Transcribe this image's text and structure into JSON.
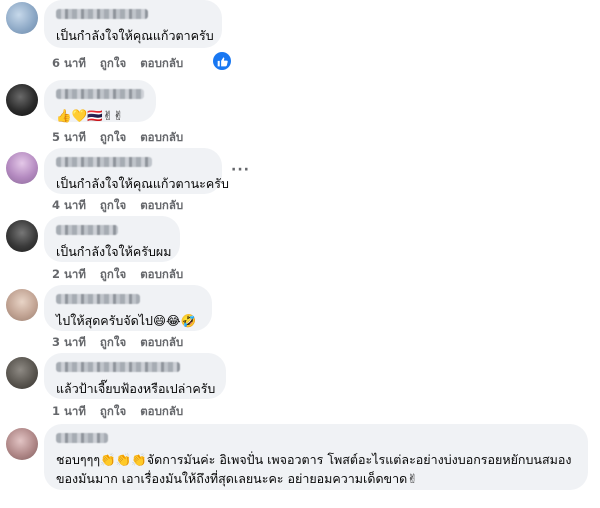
{
  "comments": [
    {
      "text": "เป็นกำลังใจให้คุณแก้วตาครับ",
      "time": "6 นาที",
      "like_label": "ถูกใจ",
      "reply_label": "ตอบกลับ",
      "reaction_icon": "like-icon"
    },
    {
      "text": "👍💛🇹🇭✌✌",
      "time": "5 นาที",
      "like_label": "ถูกใจ",
      "reply_label": "ตอบกลับ"
    },
    {
      "text": "เป็นกำลังใจให้คุณแก้วตานะครับ",
      "time": "4 นาที",
      "like_label": "ถูกใจ",
      "reply_label": "ตอบกลับ",
      "more_label": "···"
    },
    {
      "text": "เป็นกำลังใจให้ครับผม",
      "time": "2 นาที",
      "like_label": "ถูกใจ",
      "reply_label": "ตอบกลับ"
    },
    {
      "text": "ไปให้สุดครับจัดไป😄😂🤣",
      "time": "3 นาที",
      "like_label": "ถูกใจ",
      "reply_label": "ตอบกลับ"
    },
    {
      "text": "แล้วป้าเจี๊ยบฟ้องหรือเปล่าครับ",
      "time": "1 นาที",
      "like_label": "ถูกใจ",
      "reply_label": "ตอบกลับ"
    },
    {
      "text": "ชอบๆๆๆ👏👏👏จัดการมันค่ะ อิเพจปั่น เพจอวตาร โพสต์อะไรแต่ละอย่างบ่งบอกรอยหยักบนสมองของมันมาก เอาเรื่องมันให้ถึงที่สุดเลยนะคะ อย่ายอมความเด็ดขาด✌",
      "time": "1 นาที",
      "like_label": "ถูกใจ",
      "reply_label": "ตอบกลับ"
    }
  ],
  "colors": {
    "bubble": "#f0f2f5",
    "meta": "#65676b",
    "like_blue": "#1877f2"
  }
}
